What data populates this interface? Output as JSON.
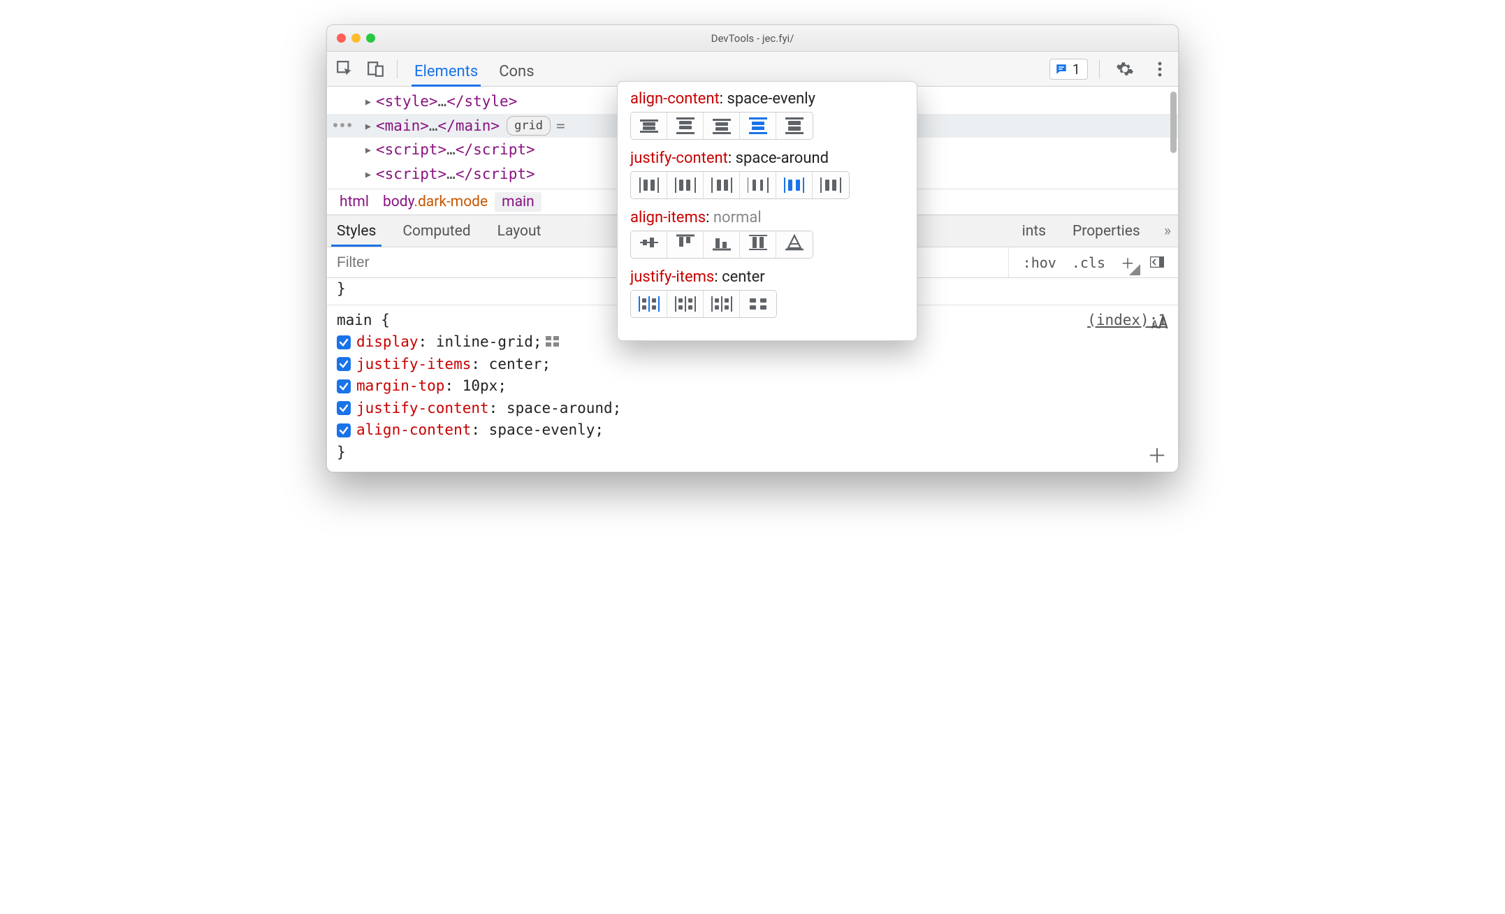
{
  "window": {
    "title": "DevTools - jec.fyi/"
  },
  "toolbar": {
    "tabs": {
      "elements": "Elements",
      "console_truncated": "Cons"
    },
    "msg_count": "1"
  },
  "dom": {
    "rows": [
      {
        "tag": "style"
      },
      {
        "tag": "main",
        "highlighted": true,
        "badge": "grid",
        "grid_equals": "="
      },
      {
        "tag": "script"
      },
      {
        "tag": "script"
      }
    ]
  },
  "crumbs": {
    "html": "html",
    "body": "body",
    "body_class": ".dark-mode",
    "main": "main"
  },
  "subtabs": {
    "styles": "Styles",
    "computed": "Computed",
    "layout": "Layout",
    "hint_partial": "ints",
    "properties": "Properties"
  },
  "filter": {
    "placeholder": "Filter",
    "hov": ":hov",
    "cls": ".cls",
    "aa": "A"
  },
  "styles_pane": {
    "prev_close": "}",
    "selector": "main {",
    "source_link": "(index):1",
    "props": [
      {
        "name": "display",
        "value": "inline-grid",
        "has_grid_icon": true
      },
      {
        "name": "justify-items",
        "value": "center"
      },
      {
        "name": "margin-top",
        "value": "10px"
      },
      {
        "name": "justify-content",
        "value": "space-around"
      },
      {
        "name": "align-content",
        "value": "space-evenly"
      }
    ],
    "close": "}"
  },
  "popover": {
    "sections": [
      {
        "prop": "align-content",
        "value": "space-evenly",
        "dim": false,
        "kind": "ac",
        "count": 5,
        "active": 3
      },
      {
        "prop": "justify-content",
        "value": "space-around",
        "dim": false,
        "kind": "jc",
        "count": 6,
        "active": 4
      },
      {
        "prop": "align-items",
        "value": "normal",
        "dim": true,
        "kind": "ai",
        "count": 5,
        "active": -1
      },
      {
        "prop": "justify-items",
        "value": "center",
        "dim": false,
        "kind": "ji",
        "count": 4,
        "active": 0
      }
    ]
  }
}
